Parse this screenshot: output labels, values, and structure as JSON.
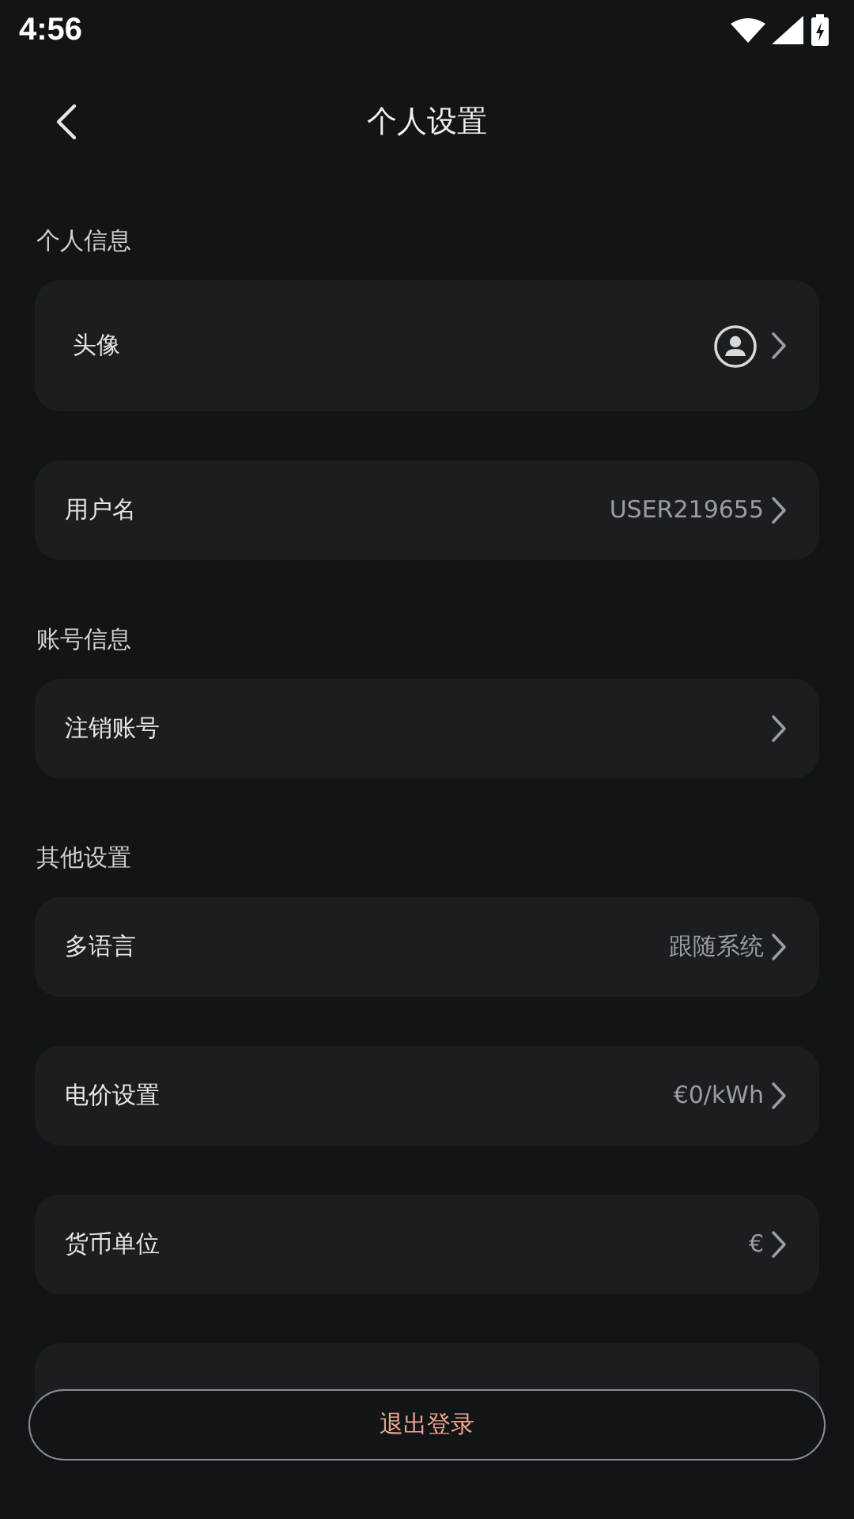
{
  "status_bar": {
    "time": "4:56"
  },
  "header": {
    "title": "个人设置"
  },
  "sections": [
    {
      "title": "个人信息",
      "rows": [
        {
          "kind": "avatar",
          "label": "头像"
        },
        {
          "kind": "value",
          "label": "用户名",
          "value": "USER219655"
        }
      ]
    },
    {
      "title": "账号信息",
      "rows": [
        {
          "kind": "link",
          "label": "注销账号"
        }
      ]
    },
    {
      "title": "其他设置",
      "rows": [
        {
          "kind": "value",
          "label": "多语言",
          "value": "跟随系统"
        },
        {
          "kind": "value",
          "label": "电价设置",
          "value": "€0/kWh"
        },
        {
          "kind": "value",
          "label": "货币单位",
          "value": "€"
        },
        {
          "kind": "covered"
        }
      ]
    }
  ],
  "logout_button": "退出登录"
}
